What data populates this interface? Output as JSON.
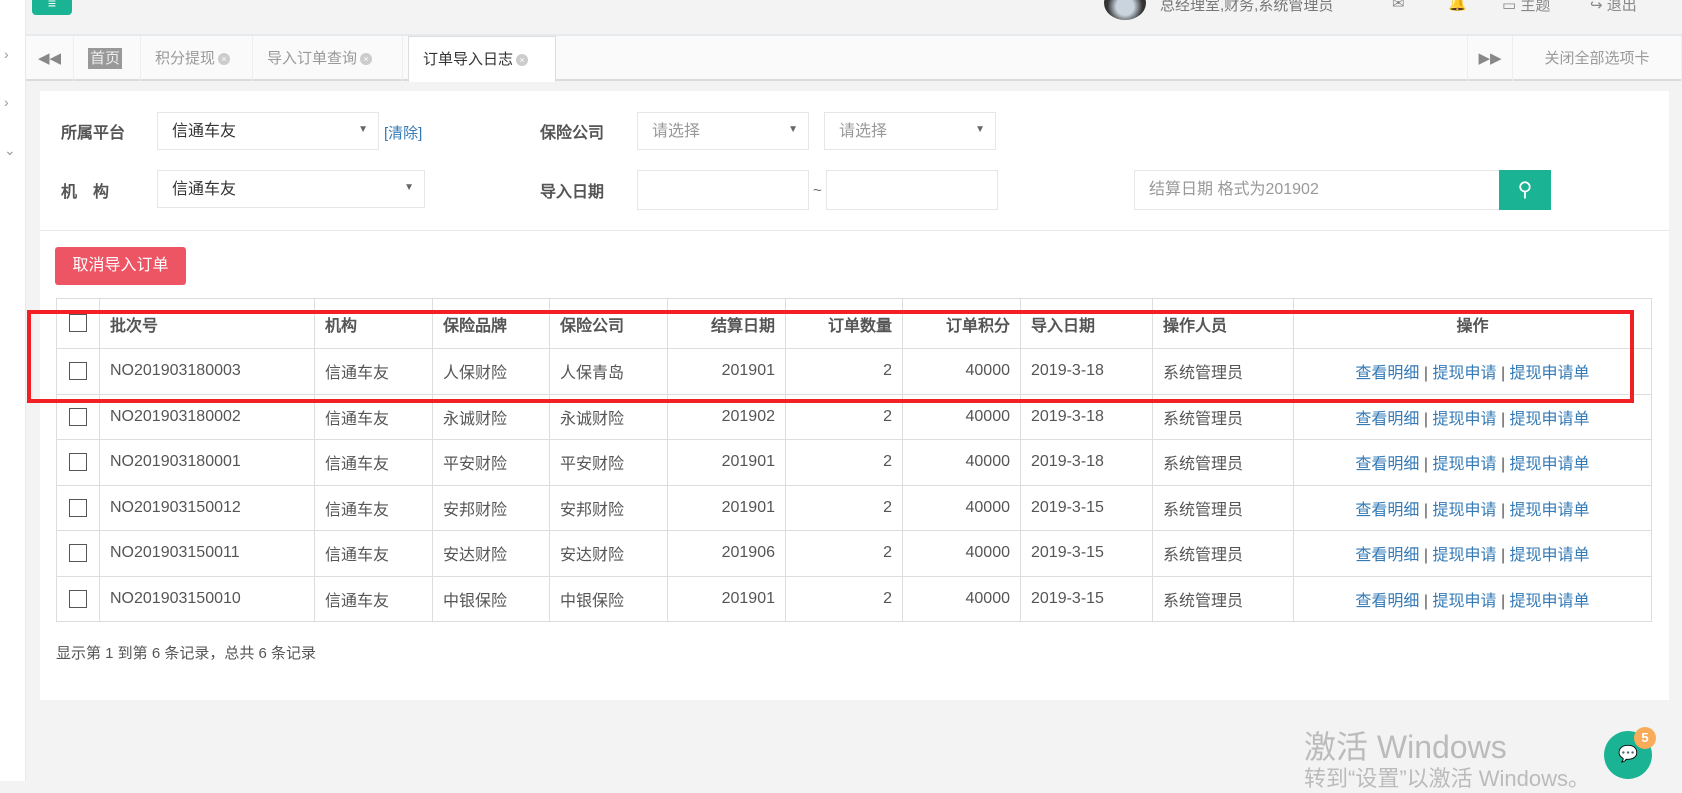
{
  "header": {
    "user": "总经理室,财务,系统管理员",
    "theme": "主题",
    "logout": "退出"
  },
  "tabs": {
    "home": "首页",
    "items": [
      "积分提现",
      "导入订单查询",
      "订单导入日志"
    ],
    "close_all": "关闭全部选项卡"
  },
  "filters": {
    "platform_label": "所属平台",
    "platform_value": "信通车友",
    "clear": "[清除]",
    "insurer_label": "保险公司",
    "insurer_ph1": "请选择",
    "insurer_ph2": "请选择",
    "org_label": "机　构",
    "org_value": "信通车友",
    "date_label": "导入日期",
    "date_sep": "~",
    "settle_ph": "结算日期 格式为201902"
  },
  "cancel_button": "取消导入订单",
  "table": {
    "headers": [
      "批次号",
      "机构",
      "保险品牌",
      "保险公司",
      "结算日期",
      "订单数量",
      "订单积分",
      "导入日期",
      "操作人员",
      "操作"
    ],
    "rows": [
      [
        "NO201903180003",
        "信通车友",
        "人保财险",
        "人保青岛",
        "201901",
        "2",
        "40000",
        "2019-3-18",
        "系统管理员"
      ],
      [
        "NO201903180002",
        "信通车友",
        "永诚财险",
        "永诚财险",
        "201902",
        "2",
        "40000",
        "2019-3-18",
        "系统管理员"
      ],
      [
        "NO201903180001",
        "信通车友",
        "平安财险",
        "平安财险",
        "201901",
        "2",
        "40000",
        "2019-3-18",
        "系统管理员"
      ],
      [
        "NO201903150012",
        "信通车友",
        "安邦财险",
        "安邦财险",
        "201901",
        "2",
        "40000",
        "2019-3-15",
        "系统管理员"
      ],
      [
        "NO201903150011",
        "信通车友",
        "安达财险",
        "安达财险",
        "201906",
        "2",
        "40000",
        "2019-3-15",
        "系统管理员"
      ],
      [
        "NO201903150010",
        "信通车友",
        "中银保险",
        "中银保险",
        "201901",
        "2",
        "40000",
        "2019-3-15",
        "系统管理员"
      ]
    ],
    "actions": [
      "查看明细",
      "提现申请",
      "提现申请单"
    ]
  },
  "footer": "显示第 1 到第 6 条记录，总共 6 条记录",
  "watermark": {
    "line1": "激活 Windows",
    "line2": "转到“设置”以激活 Windows。"
  },
  "chat_badge": "5"
}
